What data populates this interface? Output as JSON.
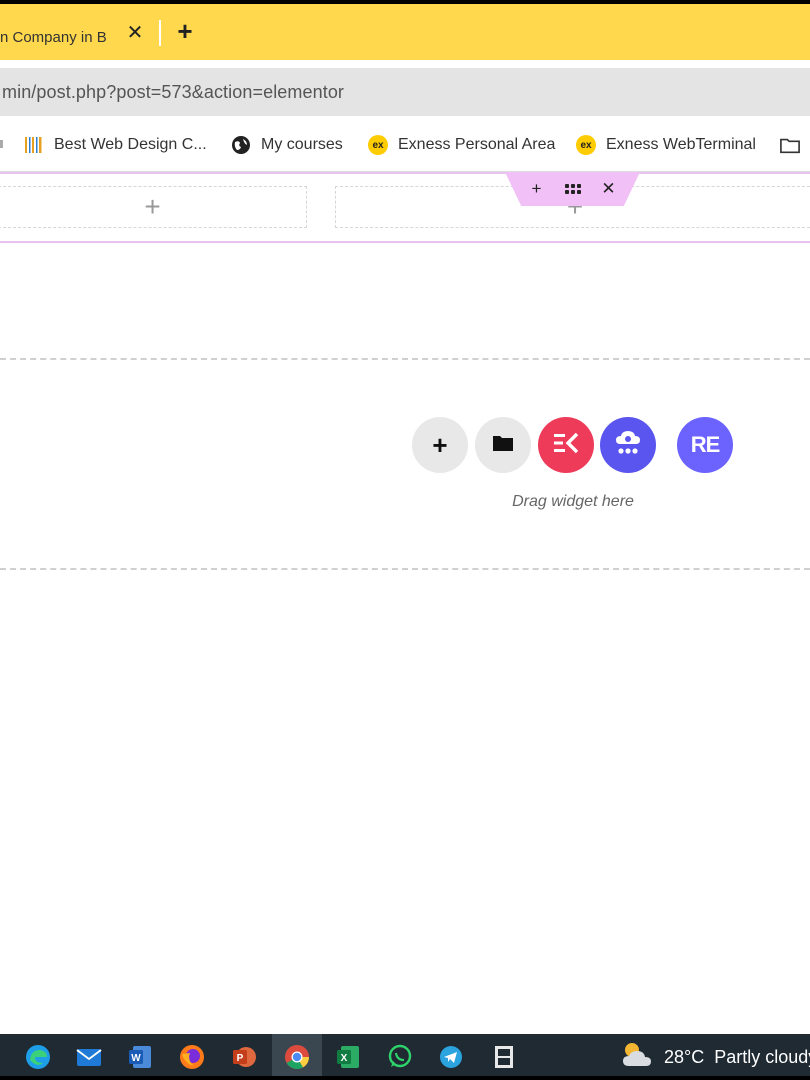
{
  "browser": {
    "tab": {
      "title": "n Company in B",
      "close_glyph": "✕"
    },
    "new_tab_glyph": "+",
    "url": "min/post.php?post=573&action=elementor"
  },
  "bookmarks": [
    {
      "label": "Best Web Design C...",
      "icon": "barcode-logo-icon"
    },
    {
      "label": "My courses",
      "icon": "globe-icon"
    },
    {
      "label": "Exness Personal Area",
      "icon": "exness-icon",
      "icon_text": "ex"
    },
    {
      "label": "Exness WebTerminal",
      "icon": "exness-icon",
      "icon_text": "ex"
    },
    {
      "label": "",
      "icon": "folder-icon"
    }
  ],
  "editor": {
    "column_add_glyph": "+",
    "section_handle": {
      "add_glyph": "+",
      "close_glyph": "✕"
    },
    "drop_zone": {
      "buttons": [
        {
          "name": "add-section-button",
          "glyph": "+",
          "bg": "#e8e8e8"
        },
        {
          "name": "add-template-button",
          "icon": "folder-icon",
          "bg": "#e8e8e8"
        },
        {
          "name": "elementskit-button",
          "icon": "ek-logo-icon",
          "bg": "#ef3b5a"
        },
        {
          "name": "cloud-library-button",
          "icon": "cloud-icon",
          "bg": "#5a55ee"
        },
        {
          "name": "royal-elementor-button",
          "icon": "re-logo-icon",
          "text": "RE",
          "bg": "#6c63ff"
        }
      ],
      "hint": "Drag widget here"
    }
  },
  "taskbar": {
    "apps": [
      "edge-icon",
      "mail-icon",
      "word-icon",
      "firefox-icon",
      "powerpoint-icon",
      "chrome-icon",
      "excel-icon",
      "whatsapp-icon",
      "telegram-icon",
      "film-icon"
    ],
    "active_app": "chrome-icon",
    "weather": {
      "temp": "28°C",
      "desc": "Partly cloudy"
    }
  },
  "colors": {
    "tab_strip": "#ffd84d",
    "section_outline": "#e9c3ef",
    "taskbar": "#1f2a33"
  }
}
